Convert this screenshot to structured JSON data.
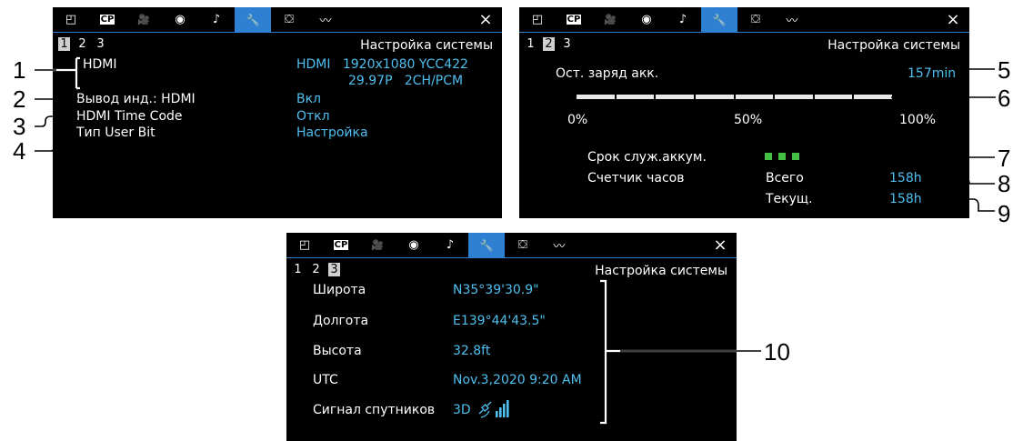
{
  "tabs": [
    {
      "name": "camera-panel-icon",
      "glyph": "◰"
    },
    {
      "name": "cp-icon",
      "glyph": "CP"
    },
    {
      "name": "movie-camera-icon",
      "glyph": "🎥"
    },
    {
      "name": "focus-icon",
      "glyph": "◉"
    },
    {
      "name": "audio-icon",
      "glyph": "♪"
    },
    {
      "name": "wrench-icon",
      "glyph": "🔧"
    },
    {
      "name": "my-menu-icon",
      "glyph": "⛋"
    },
    {
      "name": "assist-icon",
      "glyph": "〰"
    }
  ],
  "close_glyph": "×",
  "system_title": "Настройка системы",
  "page_numbers": [
    "1",
    "2",
    "3"
  ],
  "panel1": {
    "selected_page": 1,
    "rows": [
      {
        "label": "HDMI",
        "value": "HDMI   1920x1080 YCC422",
        "value2": "29.97P   2CH/PCM"
      },
      {
        "label": "Вывод инд.: HDMI",
        "value": "Вкл"
      },
      {
        "label": "HDMI Time Code",
        "value": "Откл"
      },
      {
        "label": "Тип User Bit",
        "value": "Настройка"
      }
    ],
    "callouts": [
      "1",
      "2",
      "3",
      "4"
    ]
  },
  "panel2": {
    "selected_page": 2,
    "battery_label": "Ост. заряд акк.",
    "battery_value": "157min",
    "battery_level_percent": 100,
    "scale_labels": [
      "0%",
      "50%",
      "100%"
    ],
    "life_label": "Срок служ.аккум.",
    "life_segments": 3,
    "hours_label": "Счетчик часов",
    "total_label": "Всего",
    "total_value": "158h",
    "current_label": "Текущ.",
    "current_value": "158h",
    "callouts": [
      "5",
      "6",
      "7",
      "8",
      "9"
    ]
  },
  "panel3": {
    "selected_page": 3,
    "rows": [
      {
        "label": "Широта",
        "value": "N35°39'30.9\""
      },
      {
        "label": "Долгота",
        "value": "E139°44'43.5\""
      },
      {
        "label": "Высота",
        "value": "32.8ft"
      },
      {
        "label": "UTC",
        "value": "Nov.3,2020 9:20 AM"
      },
      {
        "label": "Сигнал спутников",
        "value": "3D"
      }
    ],
    "callout": "10"
  },
  "colors": {
    "accent": "#2f80d2",
    "value_text": "#4fc0f0",
    "life_green": "#43c043"
  }
}
